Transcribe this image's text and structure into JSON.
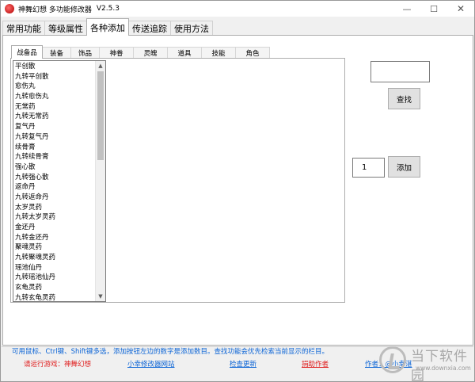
{
  "window": {
    "title": "神舞幻想 多功能修改器",
    "version": "V2.5.3",
    "controls": {
      "minimize": "—",
      "maximize": "☐",
      "close": "✕"
    }
  },
  "main_tabs": [
    "常用功能",
    "等级属性",
    "各种添加",
    "传送追踪",
    "使用方法"
  ],
  "active_main_tab": "各种添加",
  "sub_tabs": [
    "战备品",
    "装备",
    "饰品",
    "神眷",
    "灵魄",
    "道具",
    "技能",
    "角色"
  ],
  "active_sub_tab": "战备品",
  "item_list": [
    "平创散",
    "九转平创散",
    "愈伤丸",
    "九转愈伤丸",
    "无常药",
    "九转无常药",
    "复气丹",
    "九转复气丹",
    "续骨膏",
    "九转续骨膏",
    "强心散",
    "九转强心散",
    "返命丹",
    "九转返命丹",
    "太岁灵药",
    "九转太岁灵药",
    "金还丹",
    "九转金还丹",
    "聚魂灵药",
    "九转聚魂灵药",
    "瑶池仙丹",
    "九转瑶池仙丹",
    "玄龟灵药",
    "九转玄龟灵药"
  ],
  "search": {
    "value": "",
    "button_label": "查找"
  },
  "add": {
    "quantity": "1",
    "button_label": "添加"
  },
  "hint": "可用鼠标、Ctrl键、Shift键多选，添加按钮左边的数字是添加数目。查找功能会优先检索当前显示的栏目。",
  "footer": {
    "game_status": "请运行游戏：神舞幻想",
    "site_link": "小幸修改器网站",
    "update_link": "检查更新",
    "donate_link": "捐助作者",
    "author_link": "作者：@小幸湛"
  },
  "watermark": {
    "text": "当下软件园",
    "url": "www.downxia.com"
  },
  "colors": {
    "link": "#0b64d6",
    "warning": "#e02020",
    "background": "#f0f0f0"
  }
}
